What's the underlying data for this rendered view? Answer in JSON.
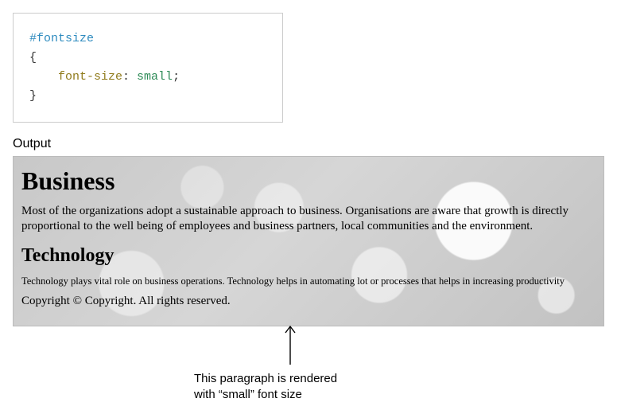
{
  "code": {
    "selector": "#fontsize",
    "open_brace": "{",
    "indent": "    ",
    "property": "font-size",
    "colon": ": ",
    "value": "small",
    "semicolon": ";",
    "close_brace": "}"
  },
  "output_label": "Output",
  "output": {
    "h1": "Business",
    "p1": "Most of the organizations adopt a sustainable approach to business. Organisations are aware that growth is directly proportional to the well being of employees and business partners, local communities and the environment.",
    "h2": "Technology",
    "p_small": "Technology plays vital role on business operations. Technology helps in automating lot or processes that helps in increasing productivity",
    "copyright": "Copyright © Copyright. All rights reserved."
  },
  "caption": "This paragraph is rendered\nwith “small” font size"
}
